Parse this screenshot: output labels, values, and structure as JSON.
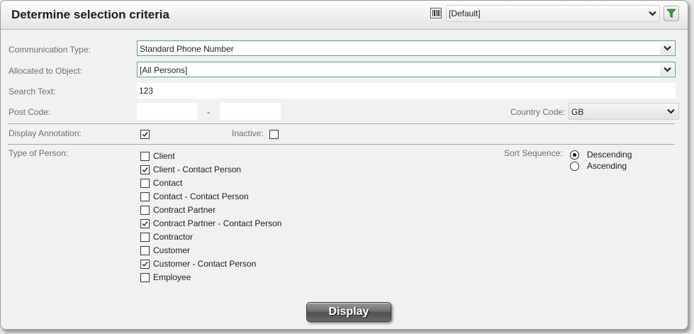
{
  "header": {
    "title": "Determine selection criteria",
    "variant_value": "[Default]"
  },
  "form": {
    "communication_type": {
      "label": "Communication Type:",
      "value": "Standard Phone Number"
    },
    "allocated_to_object": {
      "label": "Allocated to Object:",
      "value": "[All Persons]"
    },
    "search_text": {
      "label": "Search Text:",
      "value": "123"
    },
    "post_code": {
      "label": "Post Code:",
      "from": "",
      "separator": "-",
      "to": ""
    },
    "country_code": {
      "label": "Country Code:",
      "value": "GB"
    },
    "display_annotation": {
      "label": "Display Annotation:",
      "checked": true
    },
    "inactive": {
      "label": "Inactive:",
      "checked": false
    }
  },
  "type_of_person": {
    "label": "Type of Person:",
    "options": [
      {
        "label": "Client",
        "checked": false
      },
      {
        "label": "Client - Contact Person",
        "checked": true
      },
      {
        "label": "Contact",
        "checked": false
      },
      {
        "label": "Contact - Contact Person",
        "checked": false
      },
      {
        "label": "Contract Partner",
        "checked": false
      },
      {
        "label": "Contract Partner - Contact Person",
        "checked": true
      },
      {
        "label": "Contractor",
        "checked": false
      },
      {
        "label": "Customer",
        "checked": false
      },
      {
        "label": "Customer - Contact Person",
        "checked": true
      },
      {
        "label": "Employee",
        "checked": false
      }
    ]
  },
  "sort_sequence": {
    "label": "Sort Sequence:",
    "options": [
      {
        "label": "Descending",
        "selected": true
      },
      {
        "label": "Ascending",
        "selected": false
      }
    ]
  },
  "actions": {
    "display_label": "Display"
  }
}
